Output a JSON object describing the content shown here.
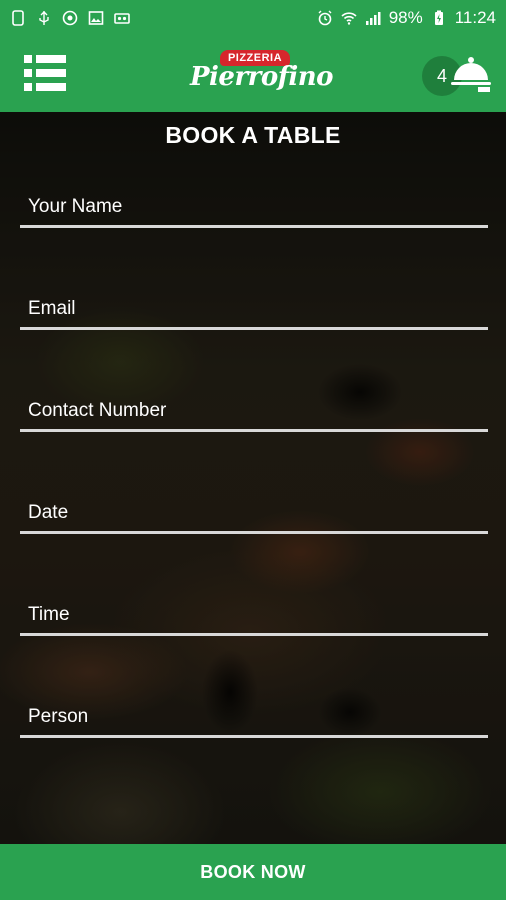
{
  "status_bar": {
    "battery": "98%",
    "time": "11:24"
  },
  "app_bar": {
    "logo_top": "PIZZERIA",
    "logo_name": "Pierrofino",
    "cart_count": "4"
  },
  "page": {
    "title": "BOOK A TABLE"
  },
  "form": {
    "fields": [
      {
        "label": "Your Name"
      },
      {
        "label": "Email"
      },
      {
        "label": "Contact Number"
      },
      {
        "label": "Date"
      },
      {
        "label": "Time"
      },
      {
        "label": "Person"
      }
    ]
  },
  "footer": {
    "book_label": "BOOK NOW"
  },
  "colors": {
    "primary": "#2aa250",
    "cart_badge": "#1f7f3c",
    "logo_red": "#d6262c"
  }
}
